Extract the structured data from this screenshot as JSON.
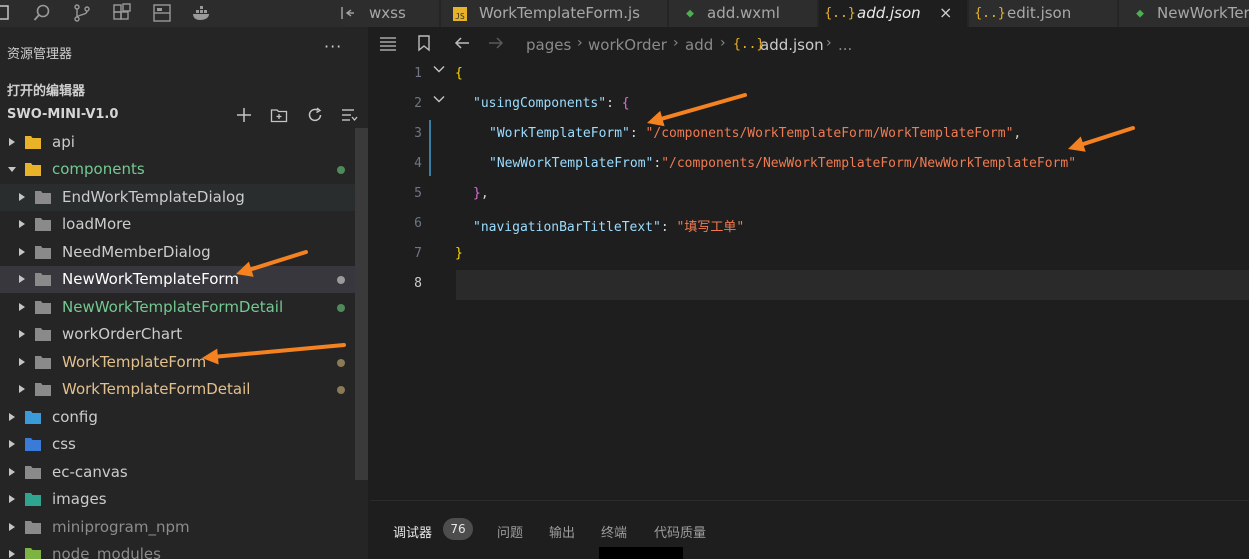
{
  "activity_bar": {
    "icons": [
      "explorer-icon",
      "search-icon",
      "source-control-icon",
      "extensions-icon",
      "layout-icon",
      "docker-icon"
    ]
  },
  "sidebar": {
    "header": "资源管理器",
    "more": "···",
    "open_editors": "打开的编辑器",
    "project": "SWO-MINI-V1.0",
    "project_actions": [
      "new-file-icon",
      "new-folder-icon",
      "refresh-icon",
      "collapse-icon"
    ],
    "tree": [
      {
        "label": "api",
        "color": "#cccccc",
        "icon_color": "#e8b229",
        "depth": 0,
        "expanded": false,
        "dot": ""
      },
      {
        "label": "components",
        "color": "#73c991",
        "icon_color": "#e8b229",
        "depth": 0,
        "expanded": true,
        "dot": "#4f8a5a"
      },
      {
        "label": "EndWorkTemplateDialog",
        "color": "#cccccc",
        "icon_color": "#8a8a8a",
        "depth": 1,
        "expanded": false,
        "dot": ""
      },
      {
        "label": "loadMore",
        "color": "#cccccc",
        "icon_color": "#8a8a8a",
        "depth": 1,
        "expanded": false,
        "dot": ""
      },
      {
        "label": "NeedMemberDialog",
        "color": "#cccccc",
        "icon_color": "#8a8a8a",
        "depth": 1,
        "expanded": false,
        "dot": ""
      },
      {
        "label": "NewWorkTemplateForm",
        "color": "#ffffff",
        "icon_color": "#8a8a8a",
        "depth": 1,
        "expanded": false,
        "dot": "#9a9a9a"
      },
      {
        "label": "NewWorkTemplateFormDetail",
        "color": "#73c991",
        "icon_color": "#8a8a8a",
        "depth": 1,
        "expanded": false,
        "dot": "#4f8a5a"
      },
      {
        "label": "workOrderChart",
        "color": "#cccccc",
        "icon_color": "#8a8a8a",
        "depth": 1,
        "expanded": false,
        "dot": ""
      },
      {
        "label": "WorkTemplateForm",
        "color": "#e2c08d",
        "icon_color": "#8a8a8a",
        "depth": 1,
        "expanded": false,
        "dot": "#8a7a55"
      },
      {
        "label": "WorkTemplateFormDetail",
        "color": "#e2c08d",
        "icon_color": "#8a8a8a",
        "depth": 1,
        "expanded": false,
        "dot": "#8a7a55"
      },
      {
        "label": "config",
        "color": "#cccccc",
        "icon_color": "#3b9bd8",
        "depth": 0,
        "expanded": false,
        "dot": ""
      },
      {
        "label": "css",
        "color": "#cccccc",
        "icon_color": "#3b7bd8",
        "depth": 0,
        "expanded": false,
        "dot": ""
      },
      {
        "label": "ec-canvas",
        "color": "#cccccc",
        "icon_color": "#8a8a8a",
        "depth": 0,
        "expanded": false,
        "dot": ""
      },
      {
        "label": "images",
        "color": "#cccccc",
        "icon_color": "#2fa58f",
        "depth": 0,
        "expanded": false,
        "dot": ""
      },
      {
        "label": "miniprogram_npm",
        "color": "#8c8c8c",
        "icon_color": "#8a8a8a",
        "depth": 0,
        "expanded": false,
        "dot": ""
      },
      {
        "label": "node_modules",
        "color": "#8c8c8c",
        "icon_color": "#7cb342",
        "depth": 0,
        "expanded": false,
        "dot": ""
      }
    ]
  },
  "tabs": [
    {
      "label": "wxss",
      "icon": "split-icon",
      "icon_text": "",
      "icon_color": "#a8a8a8",
      "active": false
    },
    {
      "label": "WorkTemplateForm.js",
      "icon": "js-file-icon",
      "icon_text": "JS",
      "icon_color": "#e8b229",
      "active": false
    },
    {
      "label": "add.wxml",
      "icon": "wxml-file-icon",
      "icon_text": "◆",
      "icon_color": "#4caf50",
      "active": false
    },
    {
      "label": "add.json",
      "icon": "json-file-icon",
      "icon_text": "{..}",
      "icon_color": "#e8b229",
      "active": true,
      "close": "×"
    },
    {
      "label": "edit.json",
      "icon": "json-file-icon",
      "icon_text": "{..}",
      "icon_color": "#e8b229",
      "active": false
    },
    {
      "label": "NewWorkTer",
      "icon": "wxml-file-icon",
      "icon_text": "◆",
      "icon_color": "#4caf50",
      "active": false
    }
  ],
  "breadcrumb": {
    "items": [
      "pages",
      "workOrder",
      "add",
      "add.json",
      "..."
    ],
    "json_icon": "{..}"
  },
  "code": {
    "current_line": 8,
    "lines": [
      {
        "num": "1",
        "fold": true,
        "indent": 0,
        "tokens": [
          {
            "t": "{",
            "c": "brace"
          }
        ]
      },
      {
        "num": "2",
        "fold": true,
        "indent": 1,
        "tokens": [
          {
            "t": "\"usingComponents\"",
            "c": "key"
          },
          {
            "t": ": ",
            "c": "k"
          },
          {
            "t": "{",
            "c": "brace2"
          }
        ]
      },
      {
        "num": "3",
        "fold": false,
        "indent": 2,
        "tokens": [
          {
            "t": "\"WorkTemplateForm\"",
            "c": "key"
          },
          {
            "t": ": ",
            "c": "k"
          },
          {
            "t": "\"/components/WorkTemplateForm/WorkTemplateForm\"",
            "c": "strr"
          },
          {
            "t": ",",
            "c": "k"
          }
        ]
      },
      {
        "num": "4",
        "fold": false,
        "indent": 2,
        "tokens": [
          {
            "t": "\"NewWorkTemplateFrom\"",
            "c": "key"
          },
          {
            "t": ":",
            "c": "k"
          },
          {
            "t": "\"/components/NewWorkTemplateForm/NewWorkTemplateForm\"",
            "c": "strr"
          }
        ]
      },
      {
        "num": "5",
        "fold": false,
        "indent": 1,
        "tokens": [
          {
            "t": "}",
            "c": "brace2"
          },
          {
            "t": ",",
            "c": "k"
          }
        ]
      },
      {
        "num": "6",
        "fold": false,
        "indent": 1,
        "tokens": [
          {
            "t": "\"navigationBarTitleText\"",
            "c": "key"
          },
          {
            "t": ": ",
            "c": "k"
          },
          {
            "t": "\"填写工单\"",
            "c": "strr"
          }
        ]
      },
      {
        "num": "7",
        "fold": false,
        "indent": 0,
        "tokens": [
          {
            "t": "}",
            "c": "brace"
          }
        ]
      },
      {
        "num": "8",
        "fold": false,
        "indent": 0,
        "tokens": []
      }
    ]
  },
  "panel": {
    "tabs": [
      "调试器",
      "问题",
      "输出",
      "终端",
      "代码质量"
    ],
    "badge": "76"
  },
  "annotation_color": "#f58220"
}
